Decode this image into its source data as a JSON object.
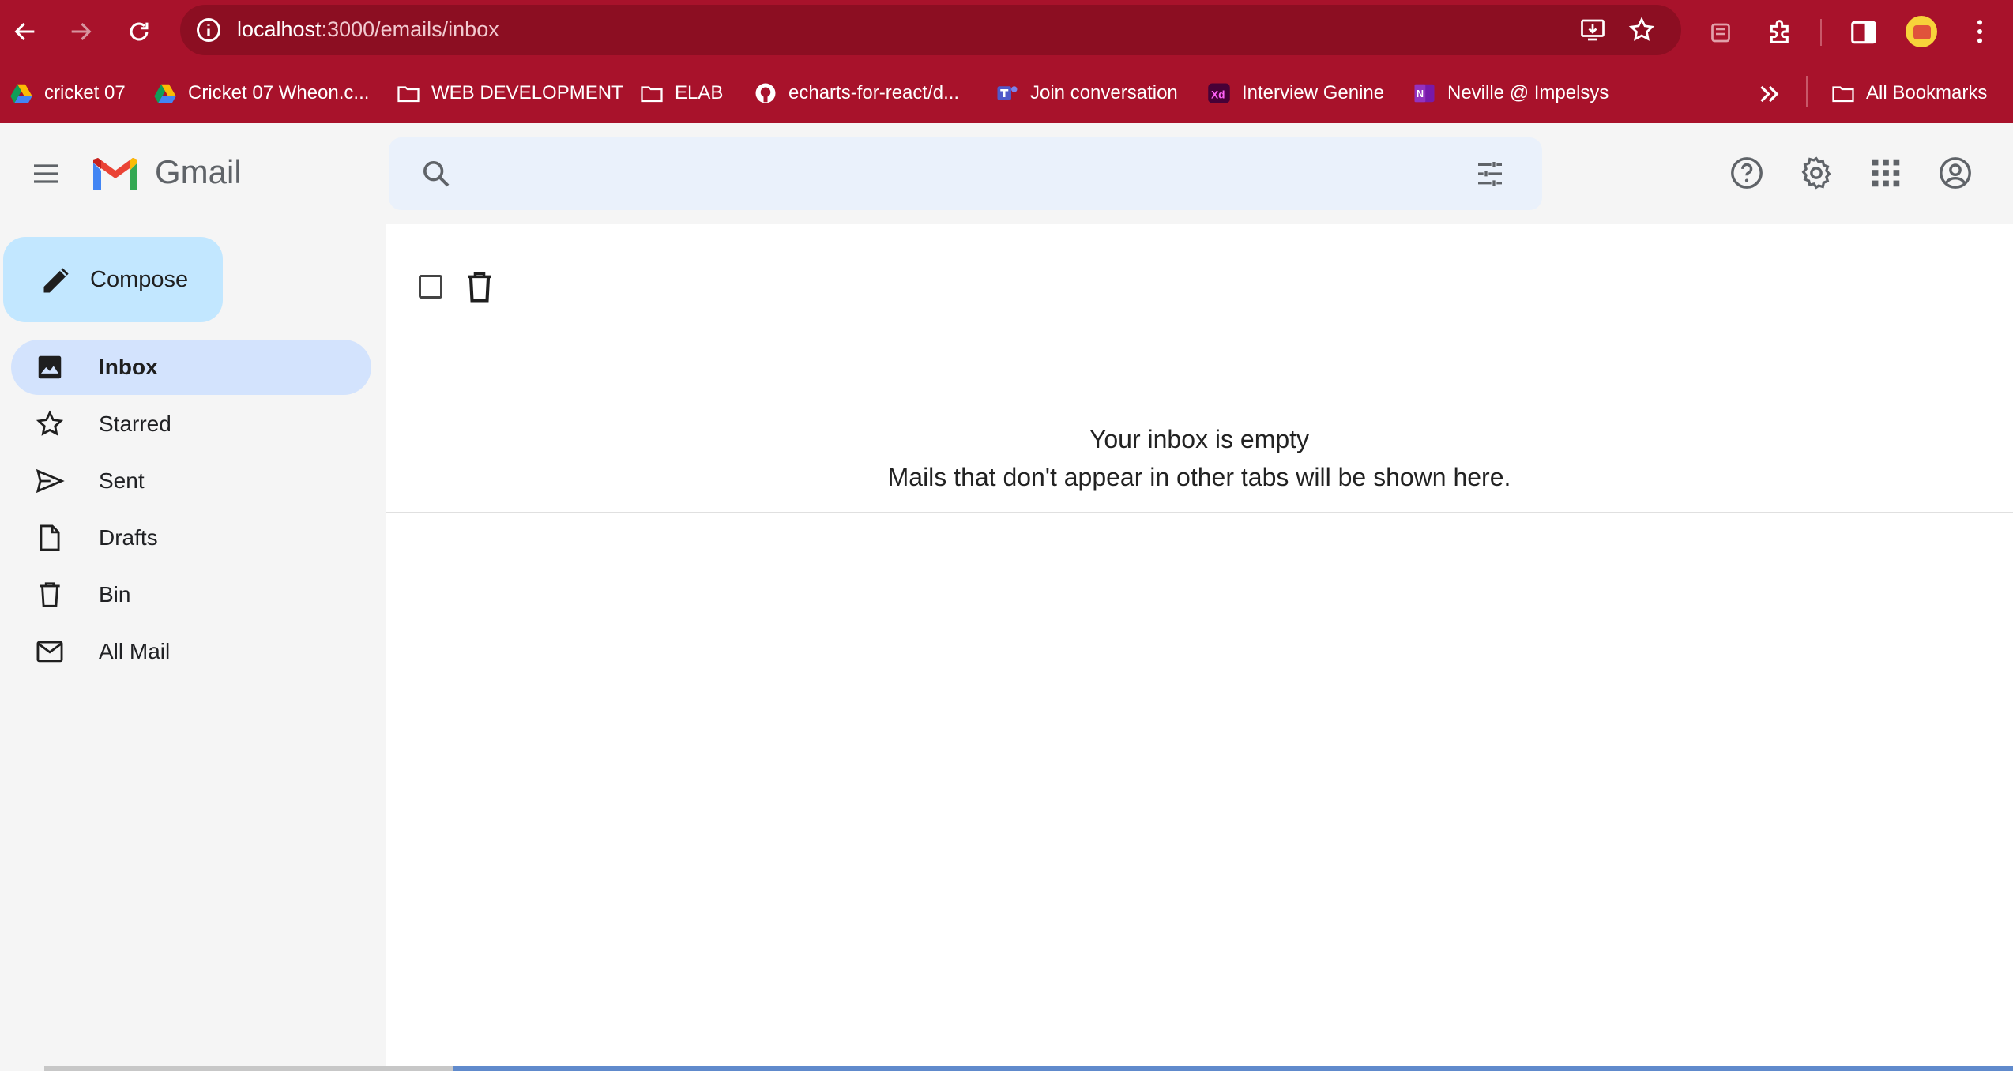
{
  "browser": {
    "url_host": "localhost",
    "url_path": ":3000/emails/inbox",
    "bookmarks": [
      {
        "label": "cricket 07",
        "icon": "drive-icon"
      },
      {
        "label": "Cricket 07 Wheon.c...",
        "icon": "drive-icon"
      },
      {
        "label": "WEB DEVELOPMENT",
        "icon": "folder-icon"
      },
      {
        "label": "ELAB",
        "icon": "folder-icon"
      },
      {
        "label": "echarts-for-react/d...",
        "icon": "github-icon"
      },
      {
        "label": "Join conversation",
        "icon": "teams-icon"
      },
      {
        "label": "Interview Genine",
        "icon": "xd-icon"
      },
      {
        "label": "Neville @ Impelsys",
        "icon": "onenote-icon"
      }
    ],
    "all_bookmarks_label": "All Bookmarks",
    "theme_color": "#a8122b"
  },
  "header": {
    "brand": "Gmail",
    "search_placeholder": ""
  },
  "sidebar": {
    "compose_label": "Compose",
    "items": [
      {
        "label": "Inbox",
        "icon": "inbox-icon",
        "active": true
      },
      {
        "label": "Starred",
        "icon": "star-icon",
        "active": false
      },
      {
        "label": "Sent",
        "icon": "send-icon",
        "active": false
      },
      {
        "label": "Drafts",
        "icon": "draft-icon",
        "active": false
      },
      {
        "label": "Bin",
        "icon": "bin-icon",
        "active": false
      },
      {
        "label": "All Mail",
        "icon": "mail-icon",
        "active": false
      }
    ]
  },
  "main": {
    "empty_title": "Your inbox is empty",
    "empty_subtitle": "Mails that don't appear in other tabs will be shown here."
  },
  "colors": {
    "compose_bg": "#c2e7ff",
    "active_nav_bg": "#d3e3fd",
    "search_bg": "#eaf1fb"
  }
}
